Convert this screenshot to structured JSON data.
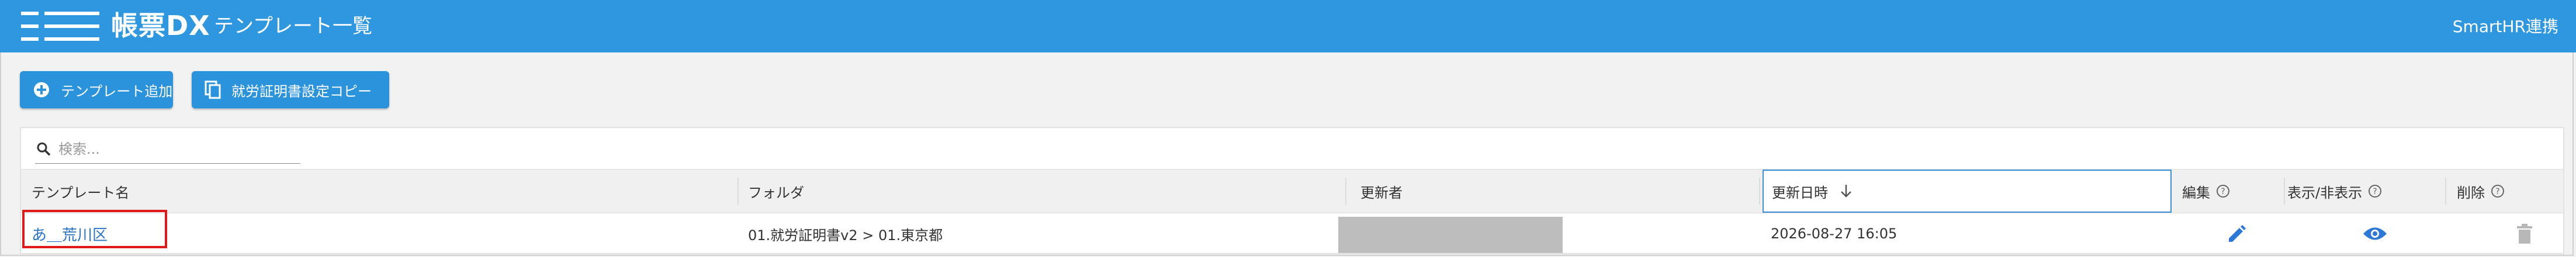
{
  "header": {
    "brand": "帳票DX",
    "page_title": "テンプレート一覧",
    "smarthr_link": "SmartHR連携"
  },
  "toolbar": {
    "add_template_label": "テンプレート追加",
    "copy_cert_settings_label": "就労証明書設定コピー"
  },
  "search": {
    "placeholder": "検索..."
  },
  "table": {
    "columns": {
      "name": "テンプレート名",
      "folder": "フォルダ",
      "updated_by": "更新者",
      "updated_at": "更新日時",
      "edit": "編集",
      "visibility": "表示/非表示",
      "delete": "削除"
    },
    "sort": {
      "column": "updated_at",
      "direction": "descending"
    },
    "rows": [
      {
        "name": "あ＿荒川区",
        "folder": "01.就労証明書v2 > 01.東京都",
        "updated_by": "",
        "updated_at": "2026-08-27 16:05"
      }
    ]
  },
  "icons": {
    "logo": "hamburger-logo-icon",
    "add": "plus-circle-icon",
    "copy": "copy-icon",
    "search": "search-icon",
    "sort": "arrow-down-icon",
    "help": "question-circle-icon",
    "edit": "pencil-icon",
    "visibility": "eye-icon",
    "delete": "trash-icon"
  },
  "colors": {
    "header_bg": "#2f97e0",
    "button_bg": "#2b92dc",
    "link": "#2a74c7",
    "highlight": "#e01919"
  }
}
